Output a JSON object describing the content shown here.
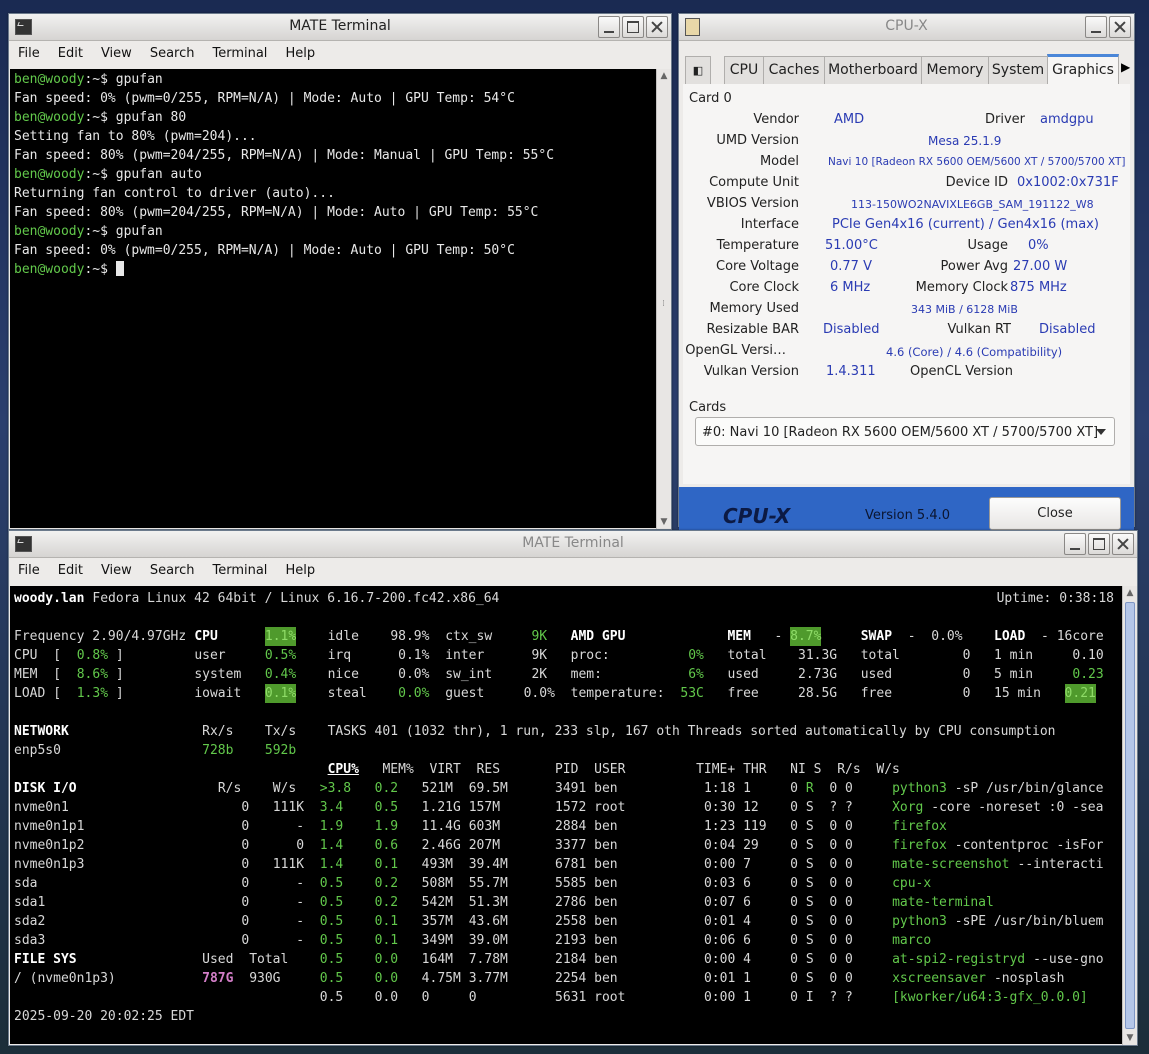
{
  "terminal1": {
    "title": "MATE Terminal",
    "menu": [
      "File",
      "Edit",
      "View",
      "Search",
      "Terminal",
      "Help"
    ],
    "lines": [
      {
        "prompt": "ben@woody",
        "path": ":~$ ",
        "cmd": "gpufan"
      },
      {
        "text": "Fan speed: 0% (pwm=0/255, RPM=N/A) | Mode: Auto | GPU Temp: 54°C"
      },
      {
        "prompt": "ben@woody",
        "path": ":~$ ",
        "cmd": "gpufan 80"
      },
      {
        "text": "Setting fan to 80% (pwm=204)..."
      },
      {
        "text": "Fan speed: 80% (pwm=204/255, RPM=N/A) | Mode: Manual | GPU Temp: 55°C"
      },
      {
        "prompt": "ben@woody",
        "path": ":~$ ",
        "cmd": "gpufan auto"
      },
      {
        "text": "Returning fan control to driver (auto)..."
      },
      {
        "text": "Fan speed: 80% (pwm=204/255, RPM=N/A) | Mode: Auto | GPU Temp: 55°C"
      },
      {
        "prompt": "ben@woody",
        "path": ":~$ ",
        "cmd": "gpufan"
      },
      {
        "text": "Fan speed: 0% (pwm=0/255, RPM=N/A) | Mode: Auto | GPU Temp: 50°C"
      },
      {
        "prompt": "ben@woody",
        "path": ":~$ ",
        "cmd": ""
      }
    ]
  },
  "cpux": {
    "title": "CPU-X",
    "tabs": [
      "CPU",
      "Caches",
      "Motherboard",
      "Memory",
      "System",
      "Graphics"
    ],
    "active_tab": "Graphics",
    "card_label": "Card 0",
    "fields": {
      "vendor_l": "Vendor",
      "vendor": "AMD",
      "driver_l": "Driver",
      "driver": "amdgpu",
      "umd_l": "UMD Version",
      "umd": "Mesa 25.1.9",
      "model_l": "Model",
      "model": "Navi 10 [Radeon RX 5600 OEM/5600 XT / 5700/5700 XT]",
      "cu_l": "Compute Unit",
      "devid_l": "Device ID",
      "devid": "0x1002:0x731F",
      "vbios_l": "VBIOS Version",
      "vbios": "113-150WO2NAVIXLE6GB_SAM_191122_W8",
      "iface_l": "Interface",
      "iface": "PCIe Gen4x16 (current) / Gen4x16 (max)",
      "temp_l": "Temperature",
      "temp": "51.00°C",
      "usage_l": "Usage",
      "usage": "0%",
      "cv_l": "Core Voltage",
      "cv": "0.77 V",
      "pavg_l": "Power Avg",
      "pavg": "27.00 W",
      "cc_l": "Core Clock",
      "cc": "6 MHz",
      "mc_l": "Memory Clock",
      "mc": "875 MHz",
      "mu_l": "Memory Used",
      "mu": "343 MiB / 6128 MiB",
      "rbar_l": "Resizable BAR",
      "rbar": "Disabled",
      "vrt_l": "Vulkan RT",
      "vrt": "Disabled",
      "ogl_l": "OpenGL Versi…",
      "ogl": "4.6 (Core) / 4.6 (Compatibility)",
      "vk_l": "Vulkan Version",
      "vk": "1.4.311",
      "ocl_l": "OpenCL Version"
    },
    "cards_label": "Cards",
    "cards_selected": "#0: Navi 10 [Radeon RX 5600 OEM/5600 XT / 5700/5700 XT]",
    "logo": "CPU-X",
    "version": "Version 5.4.0",
    "close": "Close",
    "accent": "#2f66c5"
  },
  "terminal2": {
    "title": "MATE Terminal",
    "menu": [
      "File",
      "Edit",
      "View",
      "Search",
      "Terminal",
      "Help"
    ],
    "glances": {
      "host": "woody.lan",
      "os": "Fedora Linux 42 64bit / Linux 6.16.7-200.fc42.x86_64",
      "uptime": "Uptime: 0:38:18",
      "freq": "Frequency 2.90/4.97GHz",
      "quick": [
        {
          "n": "CPU",
          "v": "0.8%"
        },
        {
          "n": "MEM",
          "v": "8.6%"
        },
        {
          "n": "LOAD",
          "v": "1.3%"
        }
      ],
      "cpu_head": "CPU",
      "cpu_total": "1.1%",
      "cpu_rows": [
        [
          "idle",
          "98.9%",
          "ctx_sw",
          "9K"
        ],
        [
          "user",
          "0.5%",
          "irq",
          "0.1%",
          "inter",
          "9K"
        ],
        [
          "system",
          "0.4%",
          "nice",
          "0.0%",
          "sw_int",
          "2K"
        ],
        [
          "iowait",
          "0.1%",
          "steal",
          "0.0%",
          "guest",
          "0.0%"
        ]
      ],
      "gpu_head": "AMD GPU",
      "gpu_rows": [
        [
          "proc:",
          "0%"
        ],
        [
          "mem:",
          "6%"
        ],
        [
          "temperature:",
          "53C"
        ]
      ],
      "mem_head": "MEM",
      "mem_pct": "8.7%",
      "mem_rows": [
        [
          "total",
          "31.3G"
        ],
        [
          "used",
          "2.73G"
        ],
        [
          "free",
          "28.5G"
        ]
      ],
      "swap_head": "SWAP",
      "swap_pct": "0.0%",
      "swap_rows": [
        [
          "total",
          "0"
        ],
        [
          "used",
          "0"
        ],
        [
          "free",
          "0"
        ]
      ],
      "load_head": "LOAD",
      "load_cores": "16core",
      "load_rows": [
        [
          "1 min",
          "0.10"
        ],
        [
          "5 min",
          "0.23"
        ],
        [
          "15 min",
          "0.21"
        ]
      ],
      "net_head": "NETWORK",
      "net_rx": "Rx/s",
      "net_tx": "Tx/s",
      "net_if": "enp5s0",
      "net_rx_v": "728b",
      "net_tx_v": "592b",
      "tasks": "TASKS 401 (1032 thr), 1 run, 233 slp, 167 oth Threads sorted automatically by CPU consumption",
      "disk_head": "DISK I/O",
      "disk_r": "R/s",
      "disk_w": "W/s",
      "disks": [
        [
          "nvme0n1",
          "0",
          "111K"
        ],
        [
          "nvme0n1p1",
          "0",
          "-"
        ],
        [
          "nvme0n1p2",
          "0",
          "0"
        ],
        [
          "nvme0n1p3",
          "0",
          "111K"
        ],
        [
          "sda",
          "0",
          "-"
        ],
        [
          "sda1",
          "0",
          "-"
        ],
        [
          "sda2",
          "0",
          "-"
        ],
        [
          "sda3",
          "0",
          "-"
        ]
      ],
      "fs_head": "FILE SYS",
      "fs_used": "Used",
      "fs_total": "Total",
      "fs_name": "/ (nvme0n1p3)",
      "fs_used_v": "787G",
      "fs_total_v": "930G",
      "proc_header": [
        "CPU%",
        "MEM%",
        "VIRT",
        "RES",
        "PID",
        "USER",
        "TIME+",
        "THR",
        "NI",
        "S",
        "R/s",
        "W/s"
      ],
      "procs": [
        [
          ">3.8",
          "0.2",
          "521M",
          "69.5M",
          "3491",
          "ben",
          "1:18",
          "1",
          "0",
          "R",
          "0",
          "0",
          "python3",
          " -sP /usr/bin/glance"
        ],
        [
          "3.4",
          "0.5",
          "1.21G",
          "157M",
          "1572",
          "root",
          "0:30",
          "12",
          "0",
          "S",
          "?",
          "?",
          "Xorg",
          " -core -noreset :0 -sea"
        ],
        [
          "1.9",
          "1.9",
          "11.4G",
          "603M",
          "2884",
          "ben",
          "1:23",
          "119",
          "0",
          "S",
          "0",
          "0",
          "firefox",
          ""
        ],
        [
          "1.4",
          "0.6",
          "2.46G",
          "207M",
          "3377",
          "ben",
          "0:04",
          "29",
          "0",
          "S",
          "0",
          "0",
          "firefox",
          " -contentproc -isFor"
        ],
        [
          "1.4",
          "0.1",
          "493M",
          "39.4M",
          "6781",
          "ben",
          "0:00",
          "7",
          "0",
          "S",
          "0",
          "0",
          "mate-screenshot",
          " --interacti"
        ],
        [
          "0.5",
          "0.2",
          "508M",
          "55.7M",
          "5585",
          "ben",
          "0:03",
          "6",
          "0",
          "S",
          "0",
          "0",
          "cpu-x",
          ""
        ],
        [
          "0.5",
          "0.2",
          "542M",
          "51.3M",
          "2786",
          "ben",
          "0:07",
          "6",
          "0",
          "S",
          "0",
          "0",
          "mate-terminal",
          ""
        ],
        [
          "0.5",
          "0.1",
          "357M",
          "43.6M",
          "2558",
          "ben",
          "0:01",
          "4",
          "0",
          "S",
          "0",
          "0",
          "python3",
          " -sPE /usr/bin/bluem"
        ],
        [
          "0.5",
          "0.1",
          "349M",
          "39.0M",
          "2193",
          "ben",
          "0:06",
          "6",
          "0",
          "S",
          "0",
          "0",
          "marco",
          ""
        ],
        [
          "0.5",
          "0.0",
          "164M",
          "7.78M",
          "2184",
          "ben",
          "0:00",
          "4",
          "0",
          "S",
          "0",
          "0",
          "at-spi2-registryd",
          " --use-gno"
        ],
        [
          "0.5",
          "0.0",
          "4.75M",
          "3.77M",
          "2254",
          "ben",
          "0:01",
          "1",
          "0",
          "S",
          "0",
          "0",
          "xscreensaver",
          " -nosplash"
        ],
        [
          "0.5",
          "0.0",
          "0",
          "0",
          "5631",
          "root",
          "0:00",
          "1",
          "0",
          "I",
          "?",
          "?",
          "[kworker/u64:3-gfx_0.0.0]",
          ""
        ]
      ],
      "datetime": "2025-09-20 20:02:25 EDT"
    }
  }
}
